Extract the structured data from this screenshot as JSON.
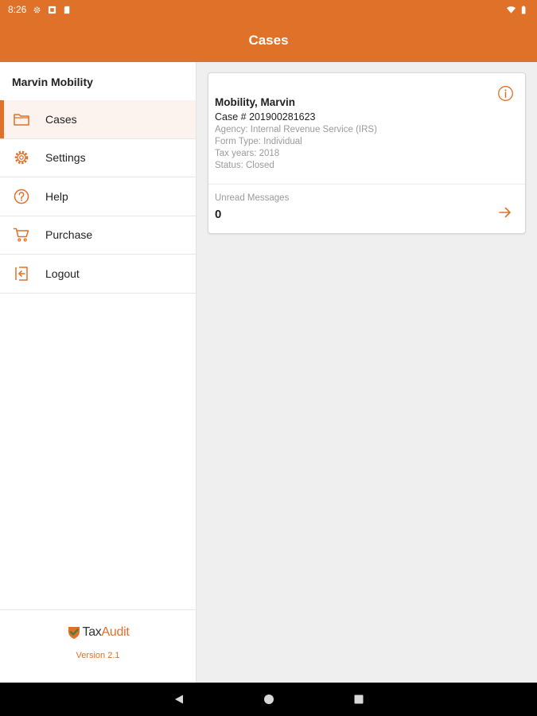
{
  "status_bar": {
    "time": "8:26"
  },
  "app_bar": {
    "title": "Cases"
  },
  "sidebar": {
    "user_name": "Marvin Mobility",
    "items": [
      {
        "label": "Cases",
        "icon": "folder-icon",
        "active": true
      },
      {
        "label": "Settings",
        "icon": "gear-icon",
        "active": false
      },
      {
        "label": "Help",
        "icon": "help-icon",
        "active": false
      },
      {
        "label": "Purchase",
        "icon": "cart-icon",
        "active": false
      },
      {
        "label": "Logout",
        "icon": "logout-icon",
        "active": false
      }
    ],
    "footer": {
      "logo_text_1": "Tax",
      "logo_text_2": "Audit",
      "version": "Version 2.1"
    }
  },
  "case_card": {
    "name": "Mobility, Marvin",
    "case_number": "Case # 201900281623",
    "agency": "Agency: Internal Revenue Service (IRS)",
    "form_type": "Form Type: Individual",
    "tax_years": "Tax years: 2018",
    "status": "Status: Closed",
    "unread_label": "Unread Messages",
    "unread_count": "0"
  },
  "colors": {
    "accent": "#e07128",
    "background": "#efefef"
  }
}
